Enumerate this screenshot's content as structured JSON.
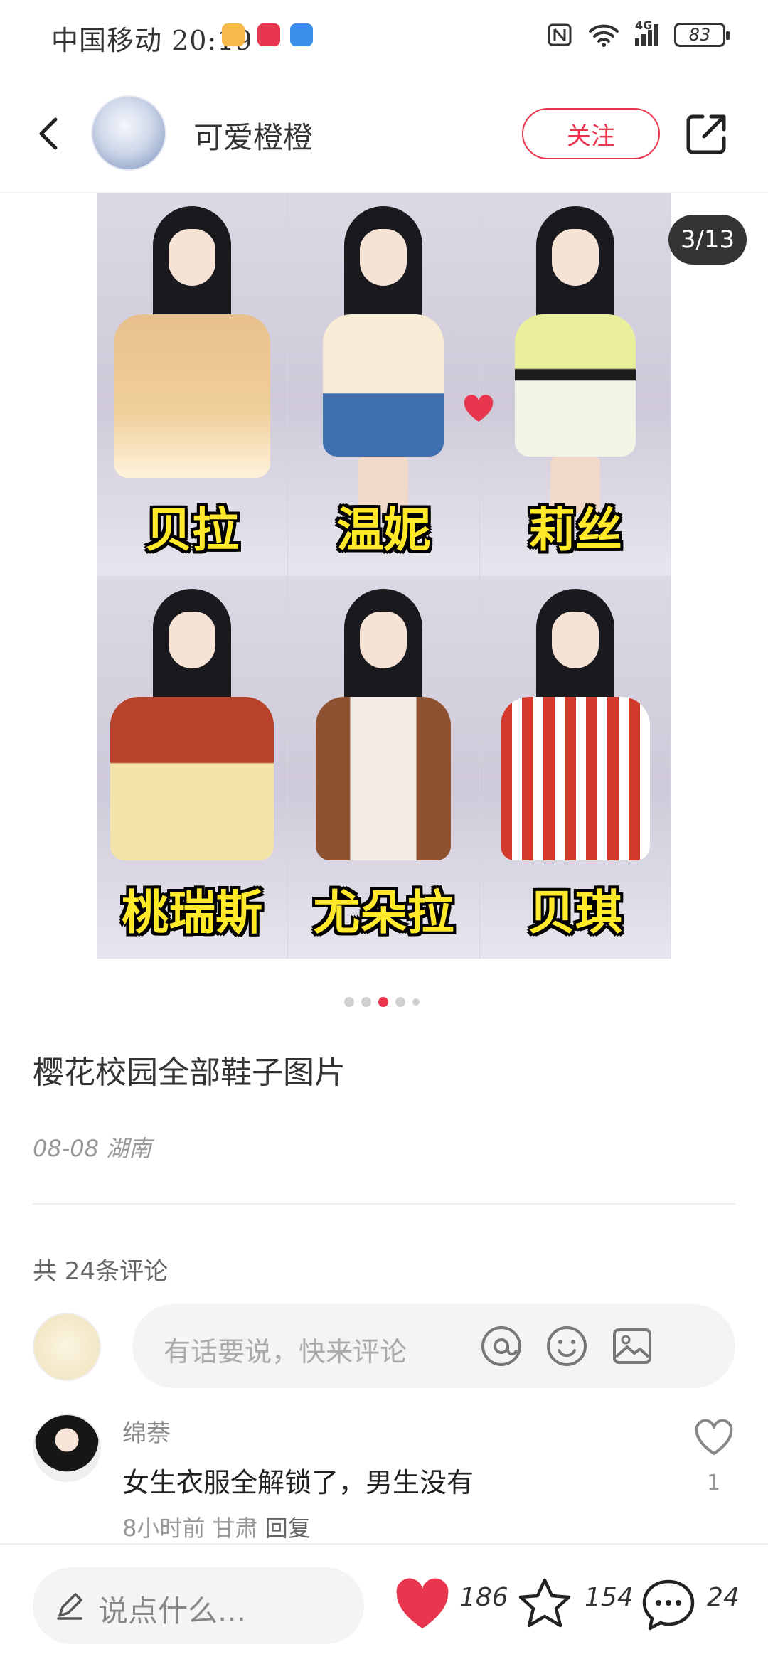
{
  "status_bar": {
    "carrier_time": "中国移动 20:19",
    "battery": "83",
    "network": "4G"
  },
  "header": {
    "author_name": "可爱橙橙",
    "follow_label": "关注"
  },
  "gallery": {
    "page_indicator": "3/13",
    "dots_total": 5,
    "dot_active_index": 2,
    "captions": [
      "贝拉",
      "温妮",
      "莉丝",
      "桃瑞斯",
      "尤朵拉",
      "贝琪"
    ]
  },
  "post": {
    "title": "樱花校园全部鞋子图片",
    "meta": "08-08 湖南",
    "comments_count_label": "共 24条评论"
  },
  "comment_input": {
    "placeholder": "有话要说，快来评论"
  },
  "comments": [
    {
      "user": "绵萘",
      "text": "女生衣服全解锁了，男生没有",
      "time": "8小时前",
      "location": "甘肃",
      "reply_label": "回复",
      "likes": "1"
    }
  ],
  "bottom_bar": {
    "say_placeholder": "说点什么...",
    "likes": "186",
    "favorites": "154",
    "comments": "24"
  },
  "colors": {
    "accent": "#e8364f",
    "text": "#222222",
    "muted": "#999999"
  }
}
